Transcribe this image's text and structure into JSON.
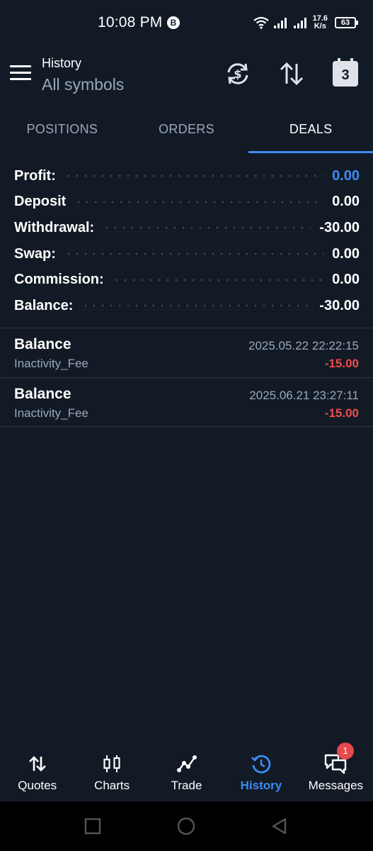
{
  "status_bar": {
    "time": "10:08 PM",
    "app_badge": "B",
    "net_speed_value": "17.6",
    "net_speed_unit": "K/s",
    "battery": "63"
  },
  "header": {
    "title": "History",
    "subtitle": "All symbols",
    "calendar_day": "3"
  },
  "tabs": [
    {
      "label": "POSITIONS",
      "active": false
    },
    {
      "label": "ORDERS",
      "active": false
    },
    {
      "label": "DEALS",
      "active": true
    }
  ],
  "summary": [
    {
      "label": "Profit:",
      "value": "0.00",
      "highlight": true
    },
    {
      "label": "Deposit",
      "value": "0.00"
    },
    {
      "label": "Withdrawal:",
      "value": "-30.00"
    },
    {
      "label": "Swap:",
      "value": "0.00"
    },
    {
      "label": "Commission:",
      "value": "0.00"
    },
    {
      "label": "Balance:",
      "value": "-30.00"
    }
  ],
  "deals": [
    {
      "type": "Balance",
      "comment": "Inactivity_Fee",
      "time": "2025.05.22 22:22:15",
      "amount": "-15.00"
    },
    {
      "type": "Balance",
      "comment": "Inactivity_Fee",
      "time": "2025.06.21 23:27:11",
      "amount": "-15.00"
    }
  ],
  "bottom_nav": [
    {
      "label": "Quotes",
      "icon": "quotes-arrows-icon",
      "active": false
    },
    {
      "label": "Charts",
      "icon": "candlestick-icon",
      "active": false
    },
    {
      "label": "Trade",
      "icon": "trend-line-icon",
      "active": false
    },
    {
      "label": "History",
      "icon": "history-clock-icon",
      "active": true
    },
    {
      "label": "Messages",
      "icon": "chat-bubbles-icon",
      "active": false,
      "badge": "1"
    }
  ],
  "colors": {
    "background": "#121a25",
    "accent": "#3d8bf2",
    "negative": "#f24b4b",
    "muted": "#9aa7bb"
  }
}
